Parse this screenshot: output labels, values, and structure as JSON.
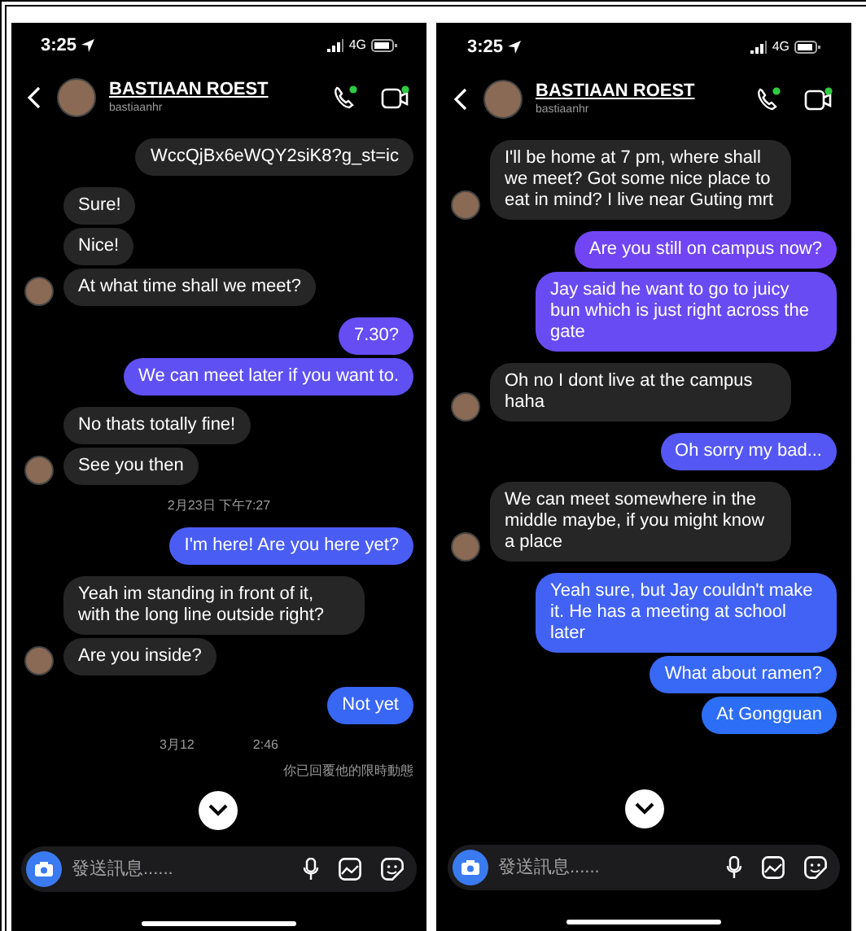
{
  "phones": [
    {
      "status_bar": {
        "time": "3:25",
        "network": "4G"
      },
      "header": {
        "name": "BASTIAAN ROEST",
        "username": "bastiaanhr"
      },
      "items": [
        {
          "kind": "link",
          "outgoing": true,
          "text": "WccQjBx6eWQY2siK8?g_st=ic"
        },
        {
          "kind": "message",
          "outgoing": false,
          "text": "Sure!"
        },
        {
          "kind": "message",
          "outgoing": false,
          "text": "Nice!"
        },
        {
          "kind": "message",
          "outgoing": false,
          "text": "At what time shall we meet?"
        },
        {
          "kind": "message",
          "outgoing": true,
          "text": "7.30?"
        },
        {
          "kind": "message",
          "outgoing": true,
          "text": "We can meet later if you want to."
        },
        {
          "kind": "message",
          "outgoing": false,
          "text": "No thats totally fine!"
        },
        {
          "kind": "message",
          "outgoing": false,
          "text": "See you then"
        },
        {
          "kind": "timestamp",
          "parts": [
            "2月23日 下午7:27"
          ]
        },
        {
          "kind": "message",
          "outgoing": true,
          "text": "I'm here! Are you here yet?"
        },
        {
          "kind": "message",
          "outgoing": false,
          "text": "Yeah im standing in front of it, with the long line outside right?"
        },
        {
          "kind": "message",
          "outgoing": false,
          "text": "Are you inside?"
        },
        {
          "kind": "message",
          "outgoing": true,
          "text": "Not yet"
        },
        {
          "kind": "timestamp",
          "parts": [
            "3月12",
            "2:46"
          ]
        },
        {
          "kind": "notice",
          "text": "你已回覆他的限時動態"
        }
      ],
      "composer": {
        "placeholder": "發送訊息......"
      }
    },
    {
      "status_bar": {
        "time": "3:25",
        "network": "4G"
      },
      "header": {
        "name": "BASTIAAN ROEST",
        "username": "bastiaanhr"
      },
      "items": [
        {
          "kind": "message",
          "outgoing": false,
          "text": "I'll be home at 7 pm, where shall we meet? Got some nice place to eat in mind? I live near Guting mrt"
        },
        {
          "kind": "message",
          "outgoing": true,
          "text": "Are you still on campus now?"
        },
        {
          "kind": "message",
          "outgoing": true,
          "text": "Jay said he want to go to juicy bun which is just right across the gate"
        },
        {
          "kind": "message",
          "outgoing": false,
          "text": "Oh no I dont live at the campus haha"
        },
        {
          "kind": "message",
          "outgoing": true,
          "text": "Oh sorry my bad..."
        },
        {
          "kind": "message",
          "outgoing": false,
          "text": "We can meet somewhere in the middle maybe, if you might know a place"
        },
        {
          "kind": "message",
          "outgoing": true,
          "text": "Yeah sure, but Jay couldn't make it. He has a meeting at school later"
        },
        {
          "kind": "message",
          "outgoing": true,
          "text": "What about ramen?"
        },
        {
          "kind": "message",
          "outgoing": true,
          "text": "At Gongguan"
        }
      ],
      "composer": {
        "placeholder": "發送訊息......"
      }
    }
  ]
}
